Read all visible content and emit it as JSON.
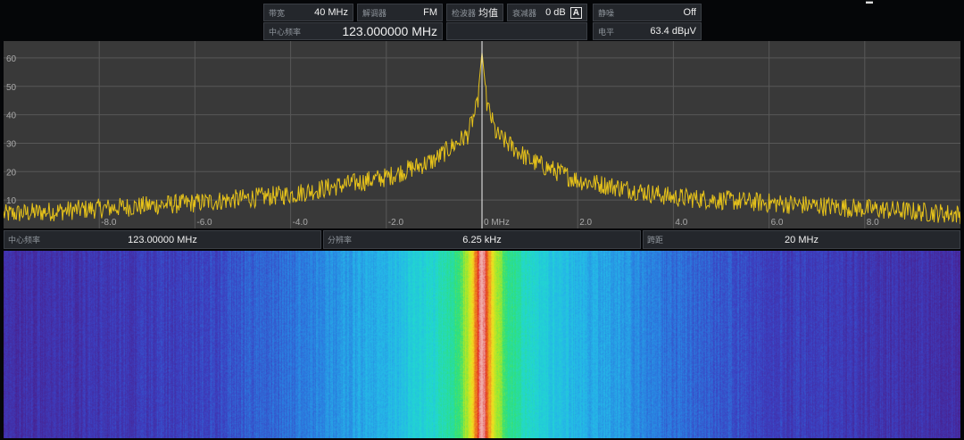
{
  "header": {
    "bandwidth": {
      "label": "带宽",
      "value": "40 MHz"
    },
    "demodulator": {
      "label": "解调器",
      "value": "FM"
    },
    "detector": {
      "label": "检波器",
      "value": "均值"
    },
    "attenuator": {
      "label": "衰减器",
      "value": "0 dB",
      "badge": "A"
    },
    "squelch": {
      "label": "静噪",
      "value": "Off"
    },
    "center_freq": {
      "label": "中心频率",
      "value": "123.000000 MHz"
    },
    "level": {
      "label": "电平",
      "value": "63.4 dBμV"
    }
  },
  "status": {
    "center_freq": {
      "label": "中心频率",
      "value": "123.00000 MHz"
    },
    "resolution": {
      "label": "分辨率",
      "value": "6.25 kHz"
    },
    "span": {
      "label": "跨距",
      "value": "20 MHz"
    }
  },
  "colors": {
    "panel_bg": "#393939",
    "trace": "#e6c21a",
    "grid": "#585858",
    "marker": "#f2f2f2"
  },
  "chart_data": {
    "type": "line",
    "x_range": [
      -10,
      10
    ],
    "y_range": [
      0,
      65
    ],
    "x_unit": "MHz",
    "y_ticks": [
      10,
      20,
      30,
      40,
      50,
      60
    ],
    "x_ticks": [
      {
        "x": -8,
        "label": "-8.0"
      },
      {
        "x": -6,
        "label": "-6.0"
      },
      {
        "x": -4,
        "label": "-4.0"
      },
      {
        "x": -2,
        "label": "-2.0"
      },
      {
        "x": 0,
        "label": "0 MHz"
      },
      {
        "x": 2,
        "label": "2.0"
      },
      {
        "x": 4,
        "label": "4.0"
      },
      {
        "x": 6,
        "label": "6.0"
      },
      {
        "x": 8,
        "label": "8.0"
      }
    ],
    "grid": true,
    "marker_x": 0,
    "peak_x": 0,
    "peak_y": 62,
    "envelope": [
      {
        "x": -10,
        "y": 6
      },
      {
        "x": -8,
        "y": 8
      },
      {
        "x": -6,
        "y": 10
      },
      {
        "x": -4,
        "y": 13
      },
      {
        "x": -2,
        "y": 19
      },
      {
        "x": -1,
        "y": 25
      },
      {
        "x": -0.3,
        "y": 34
      },
      {
        "x": -0.1,
        "y": 44
      },
      {
        "x": 0,
        "y": 62
      },
      {
        "x": 0.1,
        "y": 45
      },
      {
        "x": 0.3,
        "y": 34
      },
      {
        "x": 1,
        "y": 25
      },
      {
        "x": 2,
        "y": 18
      },
      {
        "x": 4,
        "y": 12
      },
      {
        "x": 6,
        "y": 10
      },
      {
        "x": 8,
        "y": 8
      },
      {
        "x": 10,
        "y": 6
      }
    ]
  },
  "waterfall": {
    "colormap": [
      "#4a1e8a",
      "#3c3fc0",
      "#2a7ee0",
      "#25b6e8",
      "#22d8d0",
      "#2fe07a",
      "#a8e82a",
      "#f0e020",
      "#f09020",
      "#e02a20",
      "#f0b0b0"
    ],
    "profile": [
      {
        "x": -10,
        "v": 0.05
      },
      {
        "x": -6,
        "v": 0.1
      },
      {
        "x": -4,
        "v": 0.18
      },
      {
        "x": -2,
        "v": 0.3
      },
      {
        "x": -1,
        "v": 0.4
      },
      {
        "x": -0.5,
        "v": 0.5
      },
      {
        "x": -0.3,
        "v": 0.62
      },
      {
        "x": -0.15,
        "v": 0.78
      },
      {
        "x": -0.05,
        "v": 0.95
      },
      {
        "x": 0,
        "v": 1.0
      },
      {
        "x": 0.05,
        "v": 0.95
      },
      {
        "x": 0.15,
        "v": 0.78
      },
      {
        "x": 0.3,
        "v": 0.62
      },
      {
        "x": 0.5,
        "v": 0.5
      },
      {
        "x": 1,
        "v": 0.4
      },
      {
        "x": 2,
        "v": 0.3
      },
      {
        "x": 4,
        "v": 0.18
      },
      {
        "x": 6,
        "v": 0.1
      },
      {
        "x": 10,
        "v": 0.05
      }
    ]
  }
}
